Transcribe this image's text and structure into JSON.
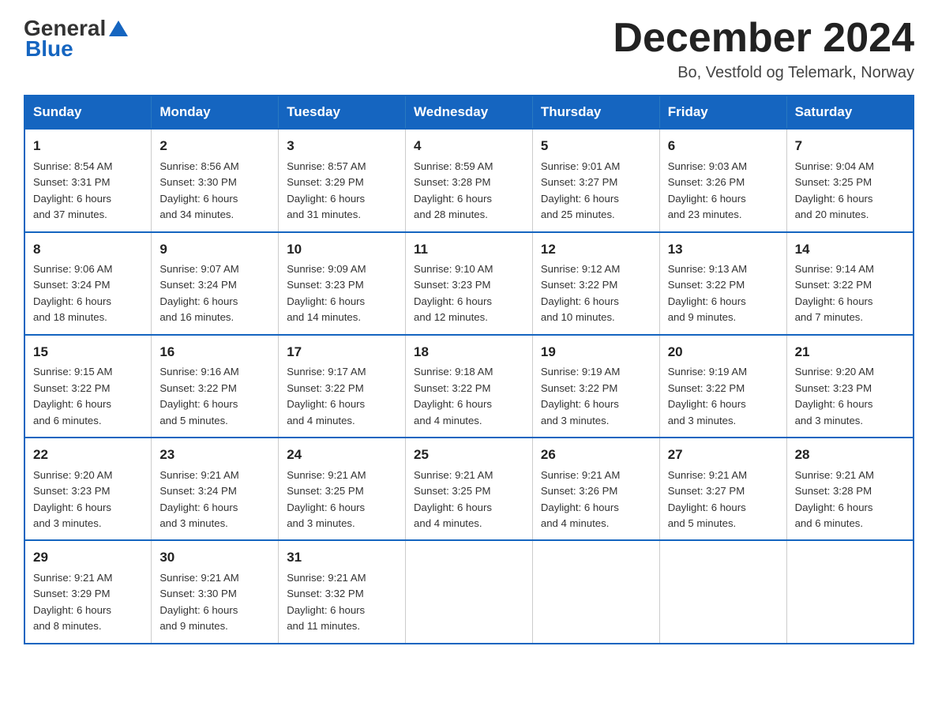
{
  "header": {
    "logo_general": "General",
    "logo_blue": "Blue",
    "title": "December 2024",
    "location": "Bo, Vestfold og Telemark, Norway"
  },
  "days_of_week": [
    "Sunday",
    "Monday",
    "Tuesday",
    "Wednesday",
    "Thursday",
    "Friday",
    "Saturday"
  ],
  "weeks": [
    [
      {
        "day": "1",
        "sunrise": "8:54 AM",
        "sunset": "3:31 PM",
        "daylight": "6 hours and 37 minutes."
      },
      {
        "day": "2",
        "sunrise": "8:56 AM",
        "sunset": "3:30 PM",
        "daylight": "6 hours and 34 minutes."
      },
      {
        "day": "3",
        "sunrise": "8:57 AM",
        "sunset": "3:29 PM",
        "daylight": "6 hours and 31 minutes."
      },
      {
        "day": "4",
        "sunrise": "8:59 AM",
        "sunset": "3:28 PM",
        "daylight": "6 hours and 28 minutes."
      },
      {
        "day": "5",
        "sunrise": "9:01 AM",
        "sunset": "3:27 PM",
        "daylight": "6 hours and 25 minutes."
      },
      {
        "day": "6",
        "sunrise": "9:03 AM",
        "sunset": "3:26 PM",
        "daylight": "6 hours and 23 minutes."
      },
      {
        "day": "7",
        "sunrise": "9:04 AM",
        "sunset": "3:25 PM",
        "daylight": "6 hours and 20 minutes."
      }
    ],
    [
      {
        "day": "8",
        "sunrise": "9:06 AM",
        "sunset": "3:24 PM",
        "daylight": "6 hours and 18 minutes."
      },
      {
        "day": "9",
        "sunrise": "9:07 AM",
        "sunset": "3:24 PM",
        "daylight": "6 hours and 16 minutes."
      },
      {
        "day": "10",
        "sunrise": "9:09 AM",
        "sunset": "3:23 PM",
        "daylight": "6 hours and 14 minutes."
      },
      {
        "day": "11",
        "sunrise": "9:10 AM",
        "sunset": "3:23 PM",
        "daylight": "6 hours and 12 minutes."
      },
      {
        "day": "12",
        "sunrise": "9:12 AM",
        "sunset": "3:22 PM",
        "daylight": "6 hours and 10 minutes."
      },
      {
        "day": "13",
        "sunrise": "9:13 AM",
        "sunset": "3:22 PM",
        "daylight": "6 hours and 9 minutes."
      },
      {
        "day": "14",
        "sunrise": "9:14 AM",
        "sunset": "3:22 PM",
        "daylight": "6 hours and 7 minutes."
      }
    ],
    [
      {
        "day": "15",
        "sunrise": "9:15 AM",
        "sunset": "3:22 PM",
        "daylight": "6 hours and 6 minutes."
      },
      {
        "day": "16",
        "sunrise": "9:16 AM",
        "sunset": "3:22 PM",
        "daylight": "6 hours and 5 minutes."
      },
      {
        "day": "17",
        "sunrise": "9:17 AM",
        "sunset": "3:22 PM",
        "daylight": "6 hours and 4 minutes."
      },
      {
        "day": "18",
        "sunrise": "9:18 AM",
        "sunset": "3:22 PM",
        "daylight": "6 hours and 4 minutes."
      },
      {
        "day": "19",
        "sunrise": "9:19 AM",
        "sunset": "3:22 PM",
        "daylight": "6 hours and 3 minutes."
      },
      {
        "day": "20",
        "sunrise": "9:19 AM",
        "sunset": "3:22 PM",
        "daylight": "6 hours and 3 minutes."
      },
      {
        "day": "21",
        "sunrise": "9:20 AM",
        "sunset": "3:23 PM",
        "daylight": "6 hours and 3 minutes."
      }
    ],
    [
      {
        "day": "22",
        "sunrise": "9:20 AM",
        "sunset": "3:23 PM",
        "daylight": "6 hours and 3 minutes."
      },
      {
        "day": "23",
        "sunrise": "9:21 AM",
        "sunset": "3:24 PM",
        "daylight": "6 hours and 3 minutes."
      },
      {
        "day": "24",
        "sunrise": "9:21 AM",
        "sunset": "3:25 PM",
        "daylight": "6 hours and 3 minutes."
      },
      {
        "day": "25",
        "sunrise": "9:21 AM",
        "sunset": "3:25 PM",
        "daylight": "6 hours and 4 minutes."
      },
      {
        "day": "26",
        "sunrise": "9:21 AM",
        "sunset": "3:26 PM",
        "daylight": "6 hours and 4 minutes."
      },
      {
        "day": "27",
        "sunrise": "9:21 AM",
        "sunset": "3:27 PM",
        "daylight": "6 hours and 5 minutes."
      },
      {
        "day": "28",
        "sunrise": "9:21 AM",
        "sunset": "3:28 PM",
        "daylight": "6 hours and 6 minutes."
      }
    ],
    [
      {
        "day": "29",
        "sunrise": "9:21 AM",
        "sunset": "3:29 PM",
        "daylight": "6 hours and 8 minutes."
      },
      {
        "day": "30",
        "sunrise": "9:21 AM",
        "sunset": "3:30 PM",
        "daylight": "6 hours and 9 minutes."
      },
      {
        "day": "31",
        "sunrise": "9:21 AM",
        "sunset": "3:32 PM",
        "daylight": "6 hours and 11 minutes."
      },
      null,
      null,
      null,
      null
    ]
  ],
  "labels": {
    "sunrise": "Sunrise:",
    "sunset": "Sunset:",
    "daylight": "Daylight:"
  }
}
